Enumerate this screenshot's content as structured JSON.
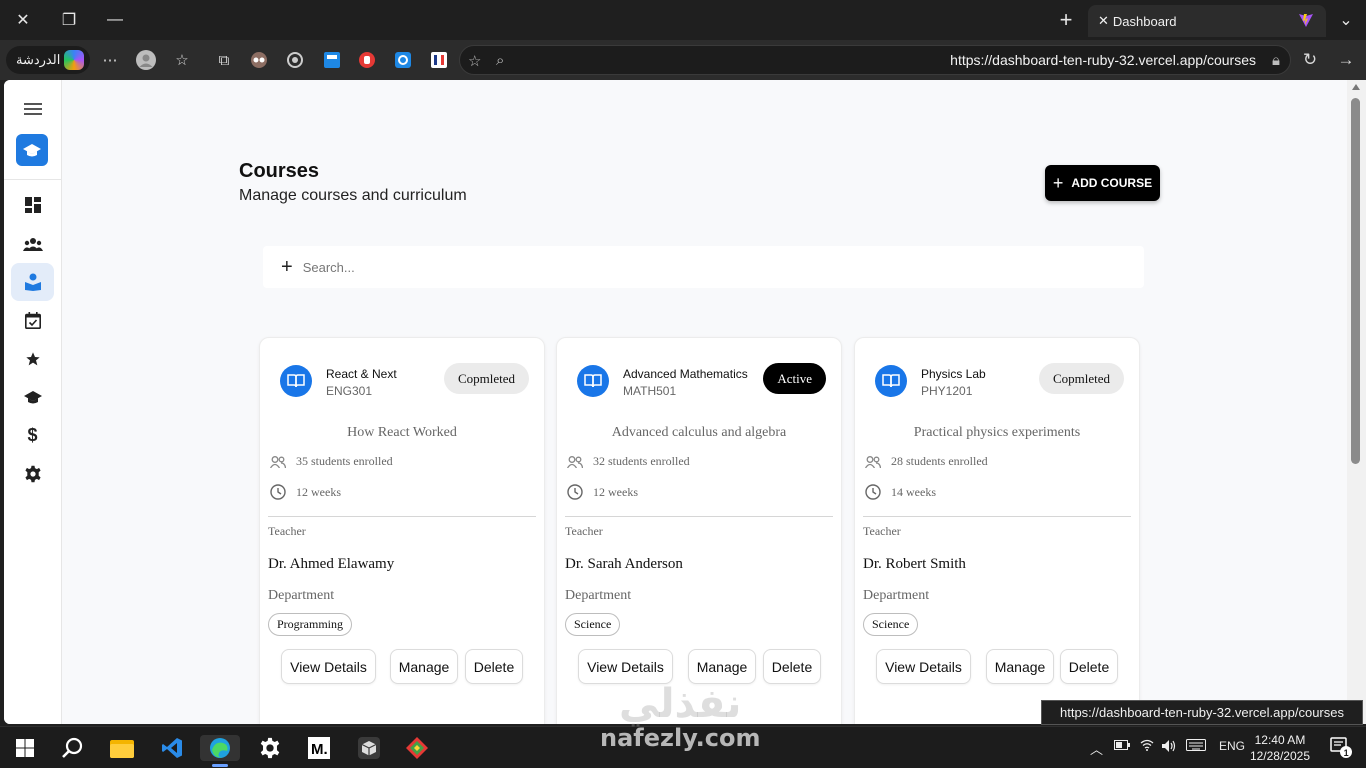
{
  "browser": {
    "tab_title": "Dashboard",
    "chat_label": "الدردشة",
    "url": "https://dashboard-ten-ruby-32.vercel.app/courses",
    "status_url": "https://dashboard-ten-ruby-32.vercel.app/courses"
  },
  "page": {
    "title": "Courses",
    "subtitle": "Manage courses and curriculum",
    "add_button": "ADD COURSE",
    "search_placeholder": "Search..."
  },
  "sidebar": {
    "items": [
      "menu",
      "dashboard",
      "users",
      "courses",
      "schedule",
      "favorites",
      "graduates",
      "finance",
      "settings"
    ],
    "active": "courses",
    "accent": "#1f7ae0"
  },
  "labels": {
    "teacher": "Teacher",
    "department": "Department",
    "view_details": "View Details",
    "manage": "Manage",
    "delete": "Delete"
  },
  "courses": [
    {
      "name": "React & Next",
      "code": "ENG301",
      "status": "Copmleted",
      "description": "How React Worked",
      "students": "35 students enrolled",
      "duration": "12 weeks",
      "teacher": "Dr. Ahmed Elawamy",
      "department": "Programming"
    },
    {
      "name": "Advanced Mathematics",
      "code": "MATH501",
      "status": "Active",
      "description": "Advanced calculus and algebra",
      "students": "32 students enrolled",
      "duration": "12 weeks",
      "teacher": "Dr. Sarah Anderson",
      "department": "Science"
    },
    {
      "name": "Physics Lab",
      "code": "PHY1201",
      "status": "Copmleted",
      "description": "Practical physics experiments",
      "students": "28 students enrolled",
      "duration": "14 weeks",
      "teacher": "Dr. Robert Smith",
      "department": "Science"
    }
  ],
  "taskbar": {
    "language": "ENG",
    "time": "12:40 AM",
    "date": "12/28/2025",
    "notifications": "1"
  },
  "watermark": {
    "arabic": "نفذلي",
    "latin": "nafezly.com"
  }
}
